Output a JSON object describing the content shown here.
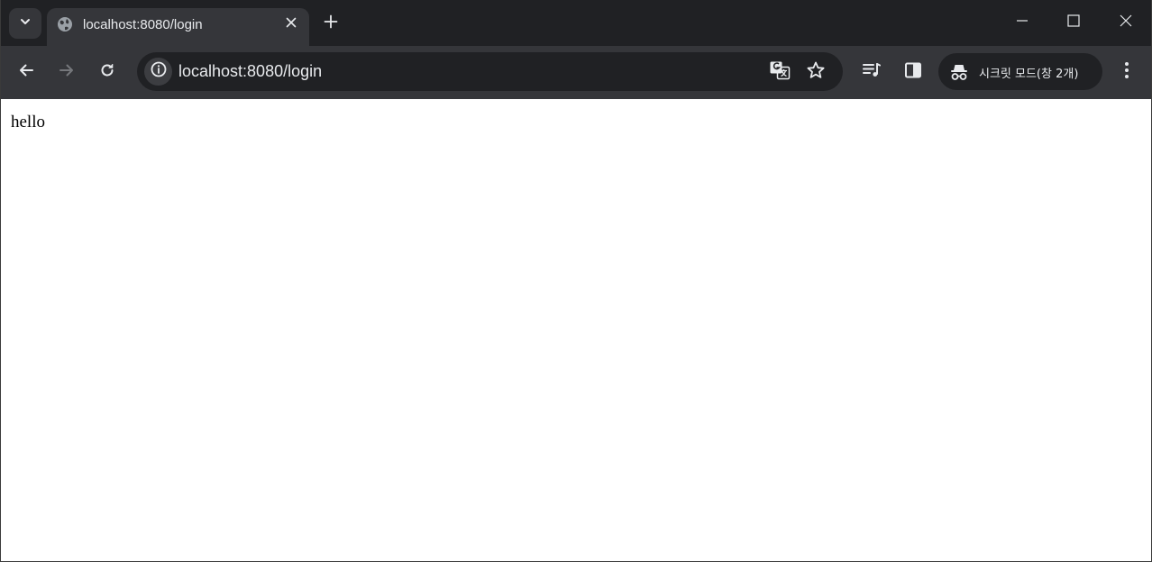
{
  "tab": {
    "title": "localhost:8080/login",
    "favicon": "globe-icon"
  },
  "toolbar": {
    "url": "localhost:8080/login",
    "incognito_label": "시크릿 모드(창 2개)"
  },
  "page": {
    "body_text": "hello"
  },
  "colors": {
    "tabstrip_bg": "#202124",
    "toolbar_bg": "#35363a",
    "omnibox_bg": "#202124",
    "icon": "#e8eaed",
    "icon_disabled": "#75777b",
    "page_bg": "#ffffff"
  }
}
